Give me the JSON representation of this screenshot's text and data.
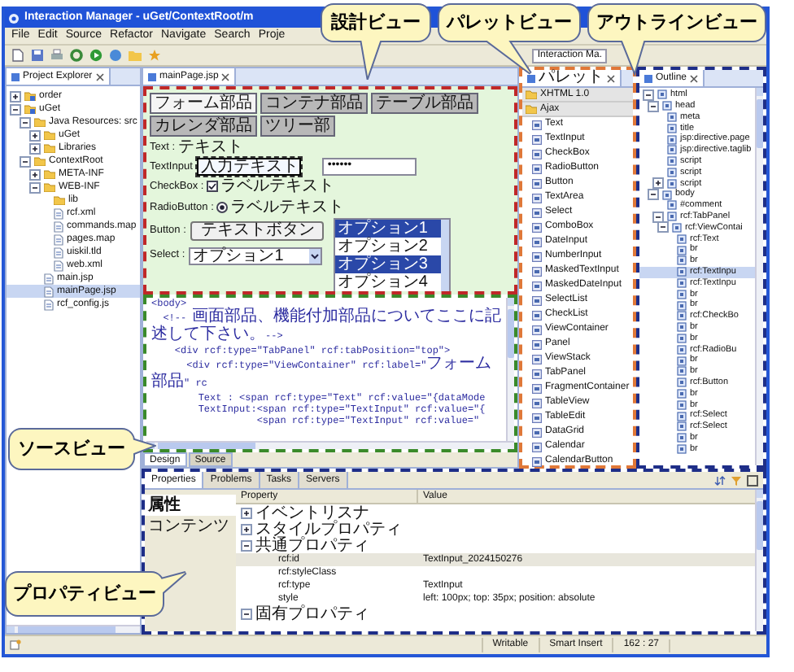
{
  "window": {
    "title": "Interaction Manager - uGet/ContextRoot/m"
  },
  "menu": [
    "File",
    "Edit",
    "Source",
    "Refactor",
    "Navigate",
    "Search",
    "Proje"
  ],
  "toolbar": {
    "perspective": "Interaction Ma."
  },
  "project_explorer": {
    "title": "Project Explorer",
    "items": [
      {
        "label": "order",
        "kind": "project",
        "expanded": false,
        "selected": false
      },
      {
        "label": "uGet",
        "kind": "project",
        "expanded": true,
        "selected": false,
        "children": [
          {
            "label": "Java Resources: src",
            "kind": "folder",
            "expanded": true,
            "selected": false,
            "children": [
              {
                "label": "uGet",
                "kind": "folder",
                "expanded": false,
                "selected": false
              },
              {
                "label": "Libraries",
                "kind": "folder",
                "expanded": false,
                "selected": false
              }
            ]
          },
          {
            "label": "ContextRoot",
            "kind": "folder",
            "expanded": true,
            "selected": false,
            "children": [
              {
                "label": "META-INF",
                "kind": "folder",
                "expanded": false,
                "selected": false
              },
              {
                "label": "WEB-INF",
                "kind": "folder",
                "expanded": true,
                "selected": false,
                "children": [
                  {
                    "label": "lib",
                    "kind": "folder",
                    "selected": false
                  },
                  {
                    "label": "rcf.xml",
                    "kind": "file",
                    "selected": false
                  },
                  {
                    "label": "commands.map",
                    "kind": "file",
                    "selected": false
                  },
                  {
                    "label": "pages.map",
                    "kind": "file",
                    "selected": false
                  },
                  {
                    "label": "uiskil.tld",
                    "kind": "file",
                    "selected": false
                  },
                  {
                    "label": "web.xml",
                    "kind": "file",
                    "selected": false
                  }
                ]
              },
              {
                "label": "main.jsp",
                "kind": "file",
                "selected": false
              },
              {
                "label": "mainPage.jsp",
                "kind": "file",
                "selected": true
              },
              {
                "label": "rcf_config.js",
                "kind": "file",
                "selected": false
              }
            ]
          }
        ]
      }
    ]
  },
  "editor": {
    "tab": "mainPage.jsp",
    "design": {
      "tabs": [
        {
          "label": "フォーム部品",
          "selected": true
        },
        {
          "label": "コンテナ部品",
          "selected": false
        },
        {
          "label": "テーブル部品",
          "selected": false
        },
        {
          "label": "カレンダ部品",
          "selected": false
        },
        {
          "label": "ツリー部",
          "selected": false
        }
      ],
      "fields": [
        {
          "kind": "text",
          "label": "Text :",
          "value": "テキスト"
        },
        {
          "kind": "textinput",
          "label": "TextInput",
          "value": "入力テキスト",
          "password": "••••••",
          "selected": true
        },
        {
          "kind": "checkbox",
          "label": "CheckBox :",
          "text": "ラベルテキスト",
          "checked": true
        },
        {
          "kind": "radio",
          "label": "RadioButton :",
          "text": "ラベルテキスト",
          "checked": true
        },
        {
          "kind": "button",
          "label": "Button :",
          "text": "テキストボタン"
        },
        {
          "kind": "select",
          "label": "Select :",
          "value": "オプション1",
          "options": [
            {
              "label": "オプション1",
              "selected": true
            },
            {
              "label": "オプション2",
              "selected": false
            },
            {
              "label": "オプション3",
              "selected": true
            },
            {
              "label": "オプション4",
              "selected": false
            }
          ]
        }
      ]
    },
    "source": {
      "lines": [
        "<body>",
        "  <!-- 画面部品、機能付加部品についてここに記述して下さい。-->",
        "    <div rcf:type=\"TabPanel\" rcf:tabPosition=\"top\">",
        "      <div rcf:type=\"ViewContainer\" rcf:label=\"フォーム部品\" rc",
        "        Text : <span rcf:type=\"Text\" rcf:value=\"{dataMode",
        "        TextInput:<span rcf:type=\"TextInput\" rcf:value=\"{",
        "                  <span rcf:type=\"TextInput\" rcf:value=\""
      ]
    },
    "modes": [
      {
        "label": "Design",
        "selected": true
      },
      {
        "label": "Source",
        "selected": false
      }
    ]
  },
  "palette": {
    "title": "パレット",
    "groups": [
      {
        "label": "XHTML 1.0"
      },
      {
        "label": "Ajax",
        "items": [
          "Text",
          "TextInput",
          "CheckBox",
          "RadioButton",
          "Button",
          "TextArea",
          "Select",
          "ComboBox",
          "DateInput",
          "NumberInput",
          "MaskedTextInput",
          "MaskedDateInput",
          "SelectList",
          "CheckList",
          "ViewContainer",
          "Panel",
          "ViewStack",
          "TabPanel",
          "FragmentContainer",
          "TableView",
          "TableEdit",
          "DataGrid",
          "Calendar",
          "CalendarButton"
        ]
      }
    ]
  },
  "outline": {
    "title": "Outline",
    "items": [
      {
        "label": "html",
        "expanded": true,
        "selected": false,
        "children": [
          {
            "label": "head",
            "expanded": true,
            "selected": false,
            "children": [
              {
                "label": "meta",
                "selected": false
              },
              {
                "label": "title",
                "selected": false
              },
              {
                "label": "jsp:directive.page",
                "selected": false
              },
              {
                "label": "jsp:directive.taglib",
                "selected": false
              },
              {
                "label": "script",
                "selected": false
              },
              {
                "label": "script",
                "selected": false
              },
              {
                "label": "script",
                "expanded": false,
                "selected": false
              }
            ]
          },
          {
            "label": "body",
            "expanded": true,
            "selected": false,
            "children": [
              {
                "label": "#comment",
                "selected": false
              },
              {
                "label": "rcf:TabPanel",
                "expanded": true,
                "selected": false,
                "children": [
                  {
                    "label": "rcf:ViewContai",
                    "expanded": true,
                    "selected": false,
                    "children": [
                      {
                        "label": "rcf:Text",
                        "selected": false
                      },
                      {
                        "label": "br",
                        "selected": false
                      },
                      {
                        "label": "br",
                        "selected": false
                      },
                      {
                        "label": "rcf:TextInpu",
                        "selected": true
                      },
                      {
                        "label": "rcf:TextInpu",
                        "selected": false
                      },
                      {
                        "label": "br",
                        "selected": false
                      },
                      {
                        "label": "br",
                        "selected": false
                      },
                      {
                        "label": "rcf:CheckBo",
                        "selected": false
                      },
                      {
                        "label": "br",
                        "selected": false
                      },
                      {
                        "label": "br",
                        "selected": false
                      },
                      {
                        "label": "rcf:RadioBu",
                        "selected": false
                      },
                      {
                        "label": "br",
                        "selected": false
                      },
                      {
                        "label": "br",
                        "selected": false
                      },
                      {
                        "label": "rcf:Button",
                        "selected": false
                      },
                      {
                        "label": "br",
                        "selected": false
                      },
                      {
                        "label": "br",
                        "selected": false
                      },
                      {
                        "label": "rcf:Select",
                        "selected": false
                      },
                      {
                        "label": "rcf:Select",
                        "selected": false
                      },
                      {
                        "label": "br",
                        "selected": false
                      },
                      {
                        "label": "br",
                        "selected": false
                      }
                    ]
                  }
                ]
              }
            ]
          }
        ]
      }
    ]
  },
  "properties": {
    "tabs": [
      {
        "label": "Properties",
        "selected": true
      },
      {
        "label": "Problems",
        "selected": false
      },
      {
        "label": "Tasks",
        "selected": false
      },
      {
        "label": "Servers",
        "selected": false
      }
    ],
    "side_tabs": [
      {
        "label": "属性",
        "selected": true
      },
      {
        "label": "コンテンツ",
        "selected": false
      }
    ],
    "columns": [
      "Property",
      "Value"
    ],
    "rows": [
      {
        "property": "イベントリスナ",
        "expanded": false
      },
      {
        "property": "スタイルプロパティ",
        "expanded": false
      },
      {
        "property": "共通プロパティ",
        "expanded": true,
        "children": [
          {
            "property": "rcf:id",
            "value": "TextInput_2024150276",
            "selected": true
          },
          {
            "property": "rcf:styleClass",
            "selected": false
          },
          {
            "property": "rcf:type",
            "value": "TextInput",
            "selected": false
          },
          {
            "property": "style",
            "value": "left: 100px; top: 35px; position: absolute",
            "selected": false
          }
        ]
      },
      {
        "property": "固有プロパティ",
        "expanded": true
      }
    ]
  },
  "status_bar": [
    "Writable",
    "Smart Insert",
    "162 : 27"
  ],
  "callouts": [
    "設計ビュー",
    "パレットビュー",
    "アウトラインビュー",
    "ソースビュー",
    "プロパティビュー"
  ]
}
